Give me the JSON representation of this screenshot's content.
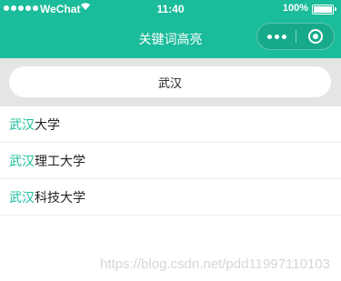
{
  "status_bar": {
    "carrier": "WeChat",
    "time": "11:40",
    "battery": "100%"
  },
  "header": {
    "title": "关键词高亮"
  },
  "search": {
    "value": "武汉"
  },
  "results": [
    {
      "highlight": "武汉",
      "rest": "大学"
    },
    {
      "highlight": "武汉",
      "rest": "理工大学"
    },
    {
      "highlight": "武汉",
      "rest": "科技大学"
    }
  ],
  "watermark": "https://blog.csdn.net/pdd11997110103",
  "colors": {
    "accent": "#1bbc9b",
    "search_bg": "#e5e5e5"
  },
  "icons": [
    "signal-dots-icon",
    "wifi-icon",
    "battery-icon",
    "more-icon",
    "home-icon"
  ]
}
